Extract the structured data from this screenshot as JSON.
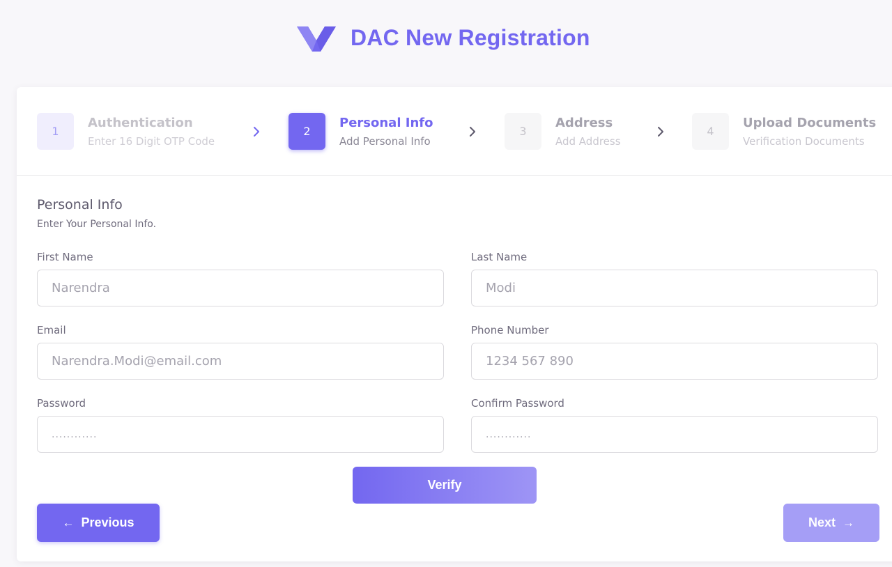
{
  "brand": {
    "title": "DAC New Registration",
    "color": "#7367f0"
  },
  "steps": [
    {
      "number": "1",
      "title": "Authentication",
      "subtitle": "Enter 16 Digit OTP Code",
      "state": "done"
    },
    {
      "number": "2",
      "title": "Personal Info",
      "subtitle": "Add Personal Info",
      "state": "active"
    },
    {
      "number": "3",
      "title": "Address",
      "subtitle": "Add Address",
      "state": "todo"
    },
    {
      "number": "4",
      "title": "Upload Documents",
      "subtitle": "Verification Documents",
      "state": "todo"
    }
  ],
  "form": {
    "title": "Personal Info",
    "subtitle": "Enter Your Personal Info.",
    "first_name": {
      "label": "First Name",
      "placeholder": "Narendra"
    },
    "last_name": {
      "label": "Last Name",
      "placeholder": "Modi"
    },
    "email": {
      "label": "Email",
      "placeholder": "Narendra.Modi@email.com"
    },
    "phone": {
      "label": "Phone Number",
      "placeholder": "1234 567 890"
    },
    "password": {
      "label": "Password",
      "placeholder": "............"
    },
    "confirm_password": {
      "label": "Confirm Password",
      "placeholder": "............"
    }
  },
  "buttons": {
    "verify": "Verify",
    "previous": "Previous",
    "previous_icon": "←",
    "next": "Next",
    "next_icon": "→"
  },
  "icons": {
    "logo": "logo-v-icon",
    "step_separator": "chevron-right-icon"
  }
}
